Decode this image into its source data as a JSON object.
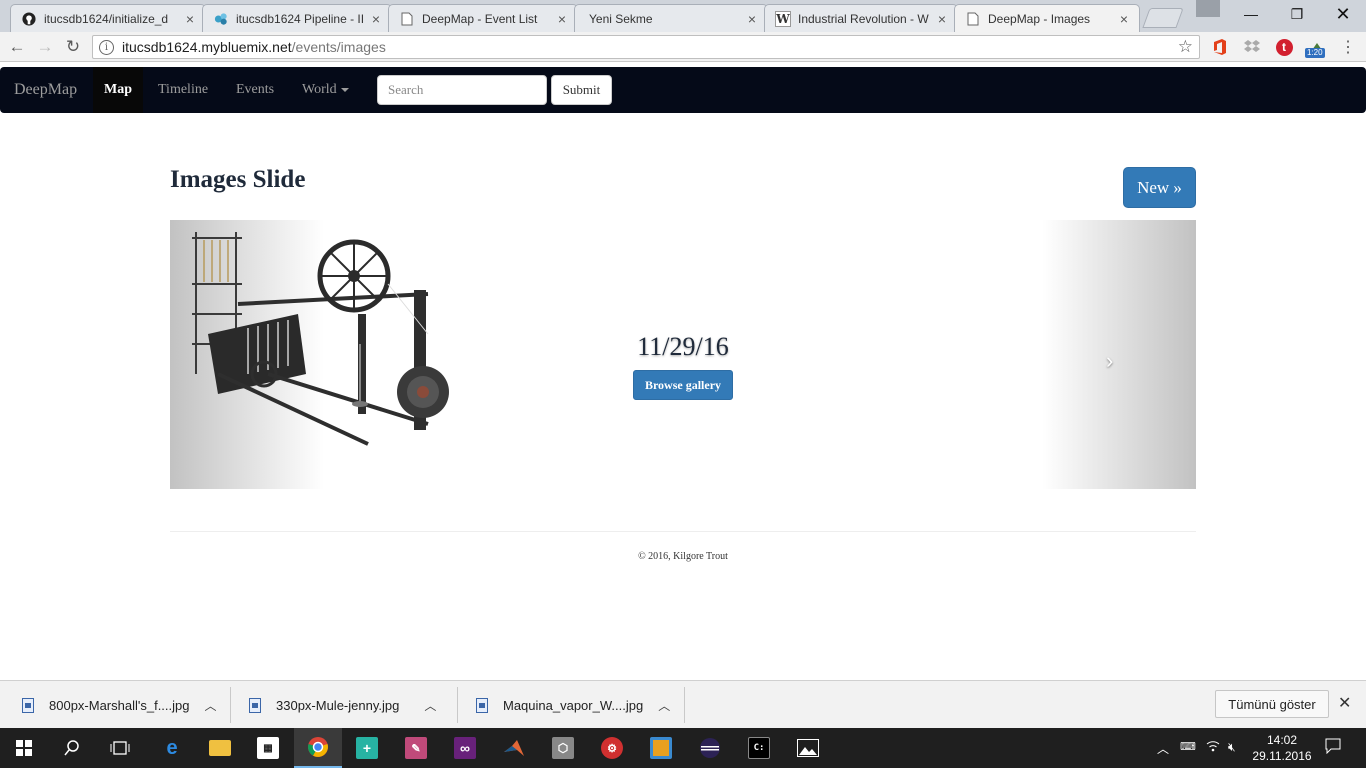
{
  "browser": {
    "tabs": [
      {
        "title": "itucsdb1624/initialize_d",
        "icon": "github-icon"
      },
      {
        "title": "itucsdb1624 Pipeline - II",
        "icon": "pipeline-icon"
      },
      {
        "title": "DeepMap - Event List",
        "icon": "page-icon"
      },
      {
        "title": "Yeni Sekme",
        "icon": ""
      },
      {
        "title": "Industrial Revolution - W",
        "icon": "wikipedia-icon"
      },
      {
        "title": "DeepMap - Images",
        "icon": "page-icon"
      }
    ],
    "url_host": "itucsdb1624.mybluemix.net",
    "url_path": "/events/images",
    "badge": "1:20"
  },
  "navbar": {
    "brand": "DeepMap",
    "links": [
      "Map",
      "Timeline",
      "Events",
      "World"
    ],
    "search_placeholder": "Search",
    "submit_label": "Submit"
  },
  "main": {
    "title": "Images Slide",
    "new_button": "New »",
    "carousel": {
      "date": "11/29/16",
      "browse_label": "Browse gallery",
      "next_glyph": "›"
    },
    "footer": "© 2016, Kilgore Trout"
  },
  "downloads": {
    "items": [
      "800px-Marshall's_f....jpg",
      "330px-Mule-jenny.jpg",
      "Maquina_vapor_W....jpg"
    ],
    "show_all": "Tümünü göster"
  },
  "taskbar": {
    "time": "14:02",
    "date": "29.11.2016"
  },
  "colors": {
    "navbar_bg": "#050a18",
    "primary_button": "#337ab7",
    "taskbar_bg": "#1f1f1f"
  }
}
